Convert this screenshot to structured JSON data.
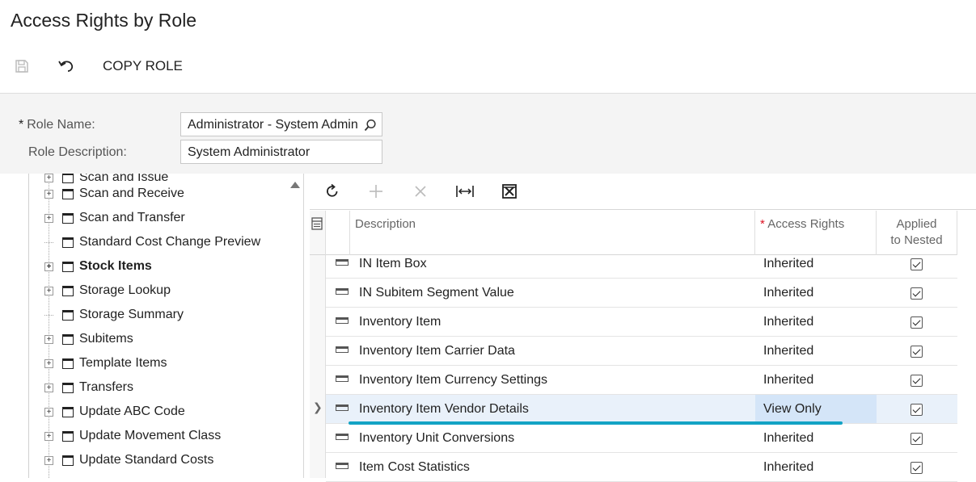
{
  "page": {
    "title": "Access Rights by Role"
  },
  "toolbar": {
    "copy_role_label": "COPY ROLE"
  },
  "form": {
    "role_name_label": "Role Name:",
    "role_name_required": "*",
    "role_name_value": "Administrator - System Admin",
    "role_description_label": "Role Description:",
    "role_description_value": "System Administrator"
  },
  "tree": {
    "partial_top": "Scan and Issue",
    "items": [
      {
        "label": "Scan and Receive",
        "expandable": true,
        "bold": false
      },
      {
        "label": "Scan and Transfer",
        "expandable": true,
        "bold": false
      },
      {
        "label": "Standard Cost Change Preview",
        "expandable": false,
        "bold": false
      },
      {
        "label": "Stock Items",
        "expandable": true,
        "bold": true
      },
      {
        "label": "Storage Lookup",
        "expandable": true,
        "bold": false
      },
      {
        "label": "Storage Summary",
        "expandable": false,
        "bold": false
      },
      {
        "label": "Subitems",
        "expandable": true,
        "bold": false
      },
      {
        "label": "Template Items",
        "expandable": true,
        "bold": false
      },
      {
        "label": "Transfers",
        "expandable": true,
        "bold": false
      },
      {
        "label": "Update ABC Code",
        "expandable": true,
        "bold": false
      },
      {
        "label": "Update Movement Class",
        "expandable": true,
        "bold": false
      },
      {
        "label": "Update Standard Costs",
        "expandable": true,
        "bold": false
      }
    ]
  },
  "grid": {
    "headers": {
      "description": "Description",
      "access_rights": "Access Rights",
      "access_rights_required": "*",
      "applied_line1": "Applied",
      "applied_line2": "to Nested"
    },
    "rows": [
      {
        "description": "IN Item Box",
        "access_rights": "Inherited",
        "applied": true
      },
      {
        "description": "IN Subitem Segment Value",
        "access_rights": "Inherited",
        "applied": true
      },
      {
        "description": "Inventory Item",
        "access_rights": "Inherited",
        "applied": true
      },
      {
        "description": "Inventory Item Carrier Data",
        "access_rights": "Inherited",
        "applied": true
      },
      {
        "description": "Inventory Item Currency Settings",
        "access_rights": "Inherited",
        "applied": true
      },
      {
        "description": "Inventory Item Vendor Details",
        "access_rights": "View Only",
        "applied": true,
        "selected": true
      },
      {
        "description": "Inventory Unit Conversions",
        "access_rights": "Inherited",
        "applied": true
      },
      {
        "description": "Item Cost Statistics",
        "access_rights": "Inherited",
        "applied": true
      }
    ]
  },
  "colors": {
    "accent": "#13a3c4",
    "selected_row": "#e9f1fa",
    "selected_cell": "#d4e5f8"
  }
}
